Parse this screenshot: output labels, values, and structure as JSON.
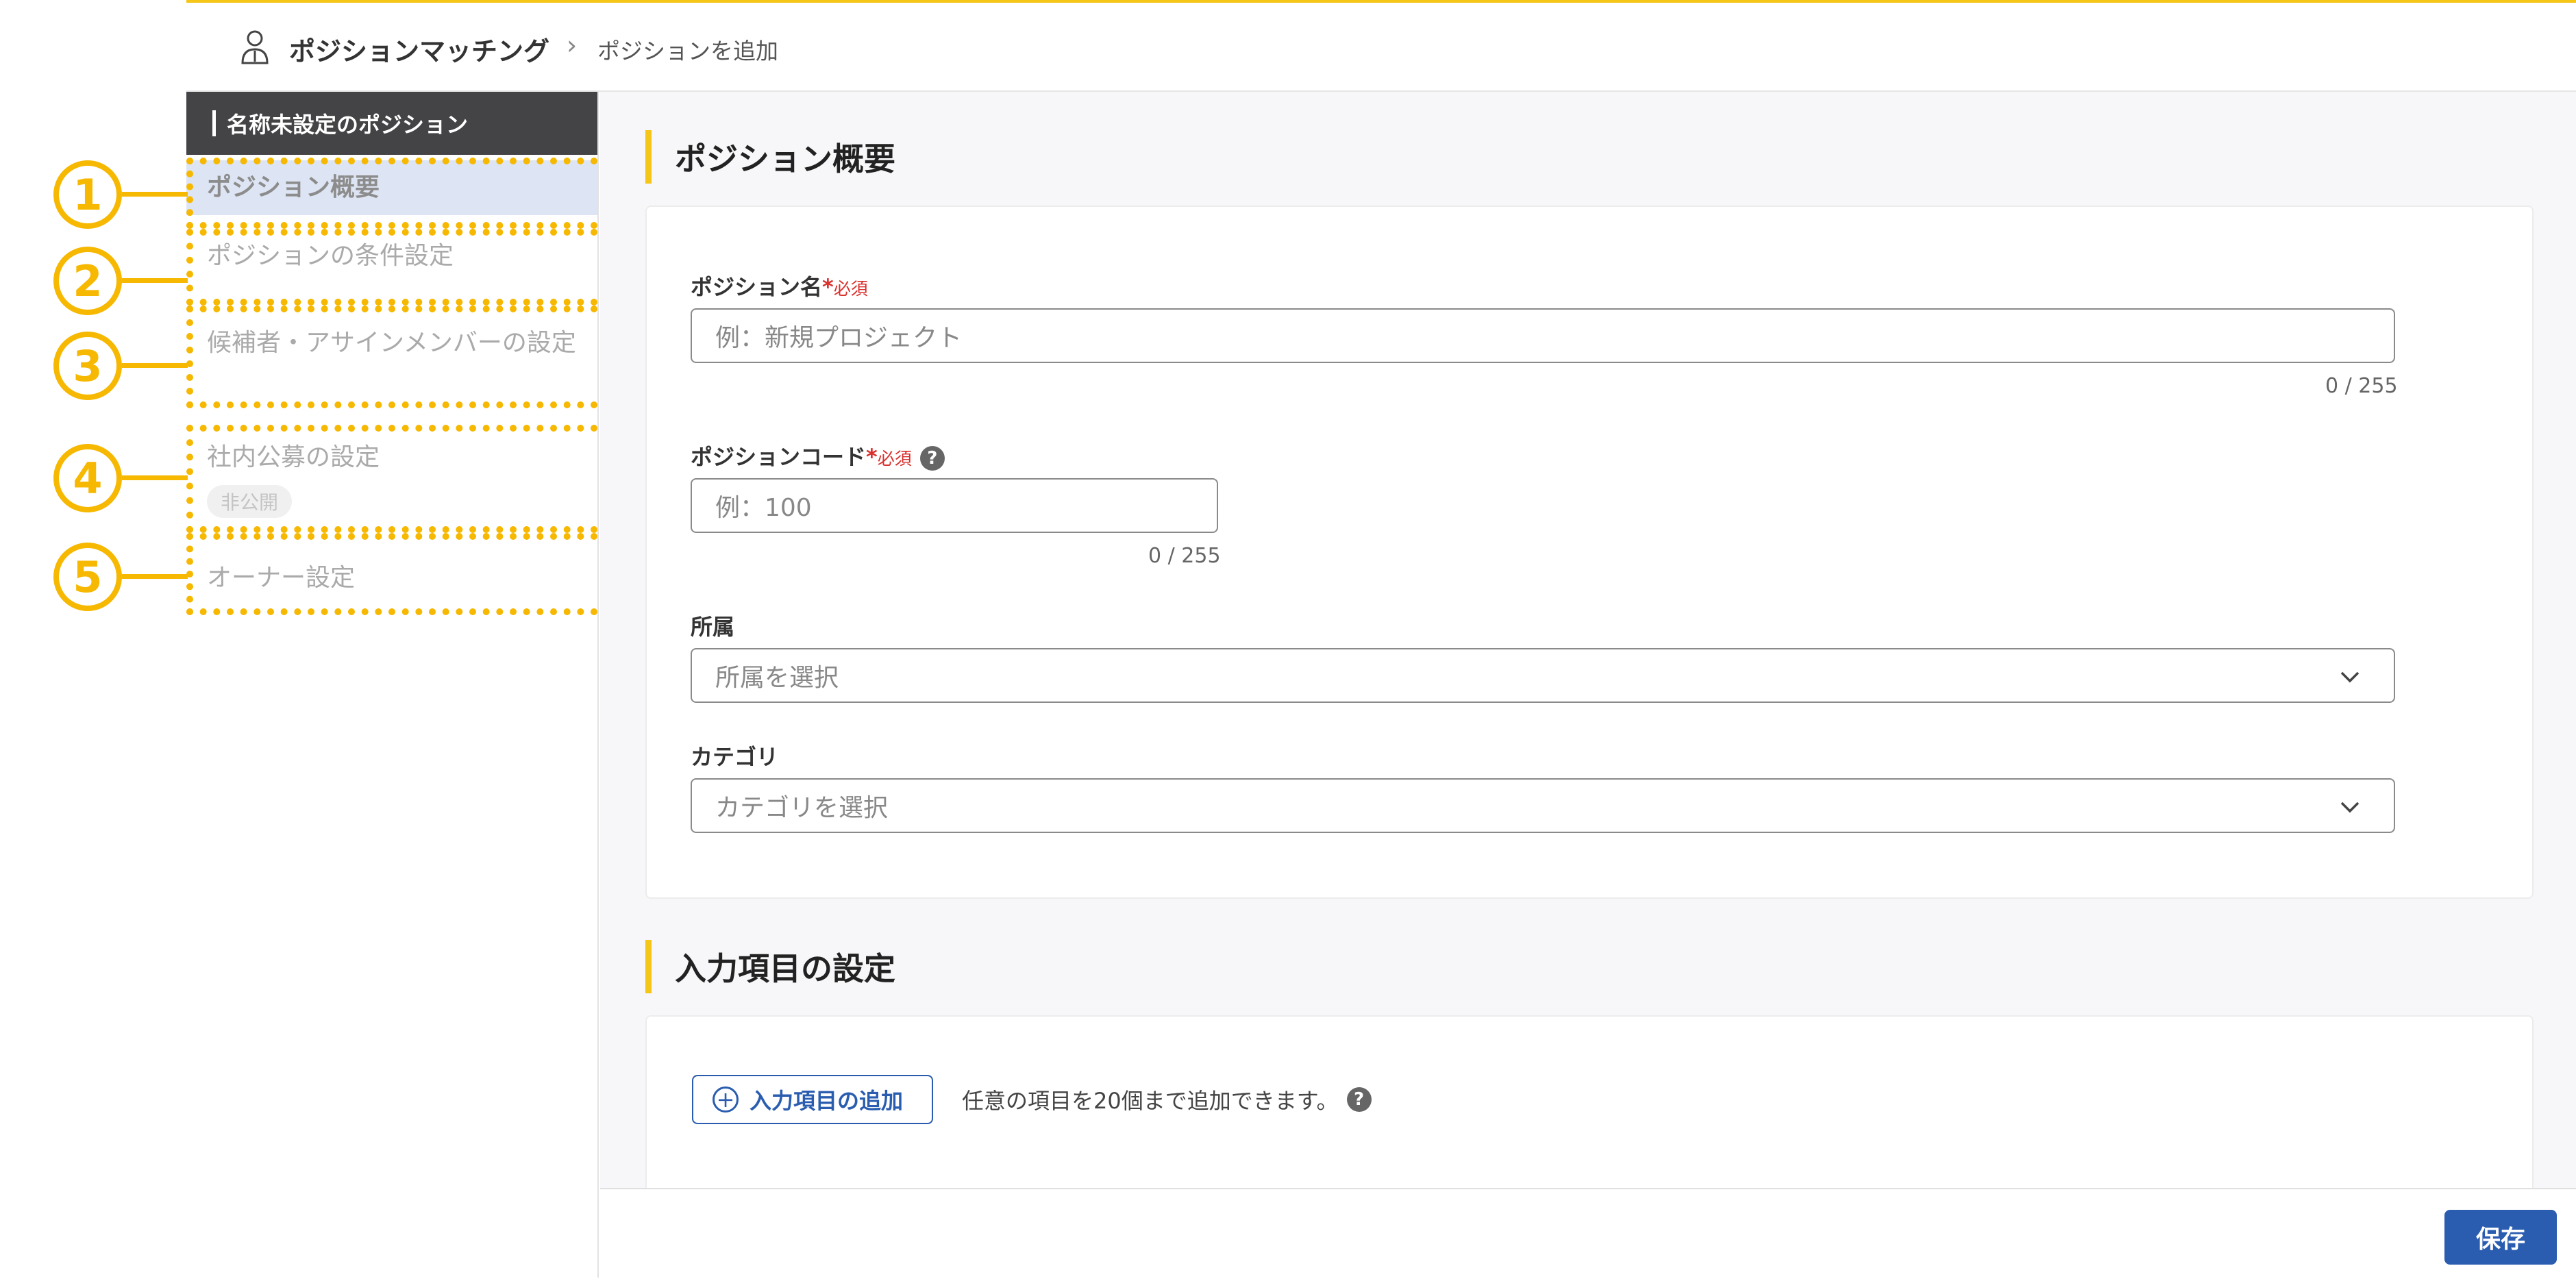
{
  "header": {
    "app_name": "ポジションマッチング",
    "separator": "›",
    "current_page": "ポジションを追加"
  },
  "sidebar": {
    "title": "名称未設定のポジション",
    "items": [
      {
        "label": "ポジション概要"
      },
      {
        "label": "ポジションの条件設定"
      },
      {
        "label": "候補者・アサインメンバーの設定"
      },
      {
        "label": "社内公募の設定",
        "badge": "非公開"
      },
      {
        "label": "オーナー設定"
      }
    ]
  },
  "callouts": [
    "1",
    "2",
    "3",
    "4",
    "5"
  ],
  "overview": {
    "heading": "ポジション概要",
    "position_name": {
      "label": "ポジション名",
      "required_mark": "*",
      "required_text": "必須",
      "placeholder": "例：新規プロジェクト",
      "counter": "0 / 255"
    },
    "position_code": {
      "label": "ポジションコード",
      "required_mark": "*",
      "required_text": "必須",
      "help": "?",
      "placeholder": "例：100",
      "counter": "0 / 255"
    },
    "affiliation": {
      "label": "所属",
      "placeholder": "所属を選択"
    },
    "category": {
      "label": "カテゴリ",
      "placeholder": "カテゴリを選択"
    }
  },
  "input_items": {
    "heading": "入力項目の設定",
    "add_button": "入力項目の追加",
    "add_icon": "+",
    "hint": "任意の項目を20個まで追加できます。",
    "help": "?"
  },
  "footer": {
    "save_label": "保存"
  },
  "colors": {
    "accent_yellow": "#f5c518",
    "callout": "#f6b800",
    "primary_blue": "#2a5db0",
    "required_red": "#d9302c",
    "sidebar_title_bg": "#444446",
    "active_item_bg": "#dde4f3"
  }
}
